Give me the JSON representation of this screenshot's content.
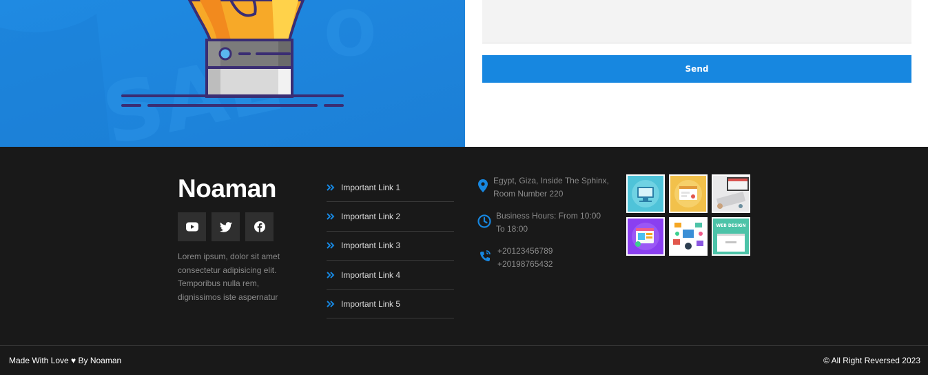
{
  "form": {
    "message_value": "",
    "send_label": "Send"
  },
  "hero": {
    "background_color": "#1e88e0",
    "illustration_icon": "lightbulb-icon"
  },
  "footer": {
    "brand": "Noaman",
    "socials": [
      {
        "icon": "youtube-icon"
      },
      {
        "icon": "twitter-icon"
      },
      {
        "icon": "facebook-icon"
      }
    ],
    "description": "Lorem ipsum, dolor sit amet consectetur adipisicing elit. Temporibus nulla rem, dignissimos iste aspernatur",
    "links": [
      {
        "label": "Important Link 1"
      },
      {
        "label": "Important Link 2"
      },
      {
        "label": "Important Link 3"
      },
      {
        "label": "Important Link 4"
      },
      {
        "label": "Important Link 5"
      }
    ],
    "contact": {
      "address_line1": "Egypt, Giza, Inside The Sphinx,",
      "address_line2": "Room Number 220",
      "hours_line1": "Business Hours: From 10:00",
      "hours_line2": "To 18:00",
      "phone1": "+20123456789",
      "phone2": "+20198765432"
    },
    "gallery": [
      {
        "icon": "web-design-thumbnail"
      },
      {
        "icon": "web-design-thumbnail"
      },
      {
        "icon": "laptop-photo-thumbnail"
      },
      {
        "icon": "web-design-thumbnail"
      },
      {
        "icon": "web-design-thumbnail"
      },
      {
        "icon": "web-design-thumbnail"
      }
    ],
    "gallery_text": "WEB DESIGN",
    "made_with": "Made With Love ♥ By Noaman",
    "copyright": "© All Right Reversed 2023",
    "accent_color": "#1787e0",
    "bg_color": "#191919"
  }
}
